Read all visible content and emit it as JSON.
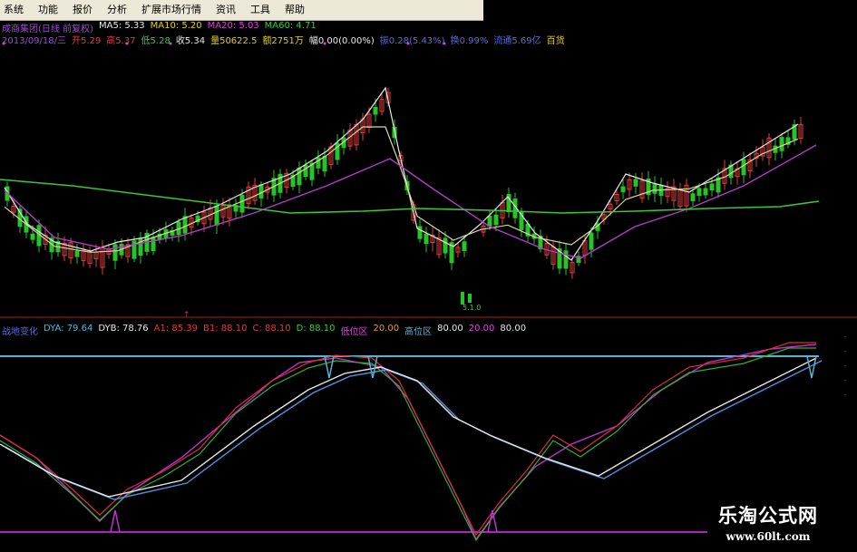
{
  "menu": [
    "系统",
    "功能",
    "报价",
    "分析",
    "扩展市场行情",
    "资讯",
    "工具",
    "帮助"
  ],
  "info_line1": {
    "title": "成商集团(日线 前复权)",
    "ma5": "MA5: 5.33",
    "ma10": "MA10: 5.20",
    "ma20": "MA20: 5.03",
    "ma60": "MA60: 4.71"
  },
  "info_line2": {
    "date": "2013/09/18/三",
    "open": "开5.29",
    "high": "高5.37",
    "low": "低5.28",
    "close": "收5.34",
    "volume": "量50622.5",
    "amount": "额2751万",
    "change": "幅0.00(0.00%)",
    "range": "振0.28(5.43%)",
    "turnover": "换0.99%",
    "float": "流通5.69亿",
    "sector": "百货"
  },
  "bottom_label": "5.1.0",
  "indicator_line": {
    "name": "战地变化",
    "dya": "DYA: 79.64",
    "dyb": "DYB: 78.76",
    "a1": "A1: 85.39",
    "b1": "B1: 88.10",
    "c1": "C: 88.10",
    "d1": "D: 88.10",
    "low_zone_label": "低位区",
    "low_zone_value": "20.00",
    "high_zone_label": "高位区",
    "high_zone_value": "80.00",
    "v1": "20.00",
    "v2": "80.00"
  },
  "watermark": {
    "title": "乐淘公式网",
    "url": "www.60lt.com"
  },
  "colors": {
    "up": "#e23b3b",
    "down": "#26c426",
    "ma5": "#e8e8e8",
    "ma10": "#d8d8a0",
    "ma20": "#b43cc8",
    "ma60": "#3cc43c",
    "upper_line": "#56b4d6",
    "lower_line": "#b020c0"
  }
}
